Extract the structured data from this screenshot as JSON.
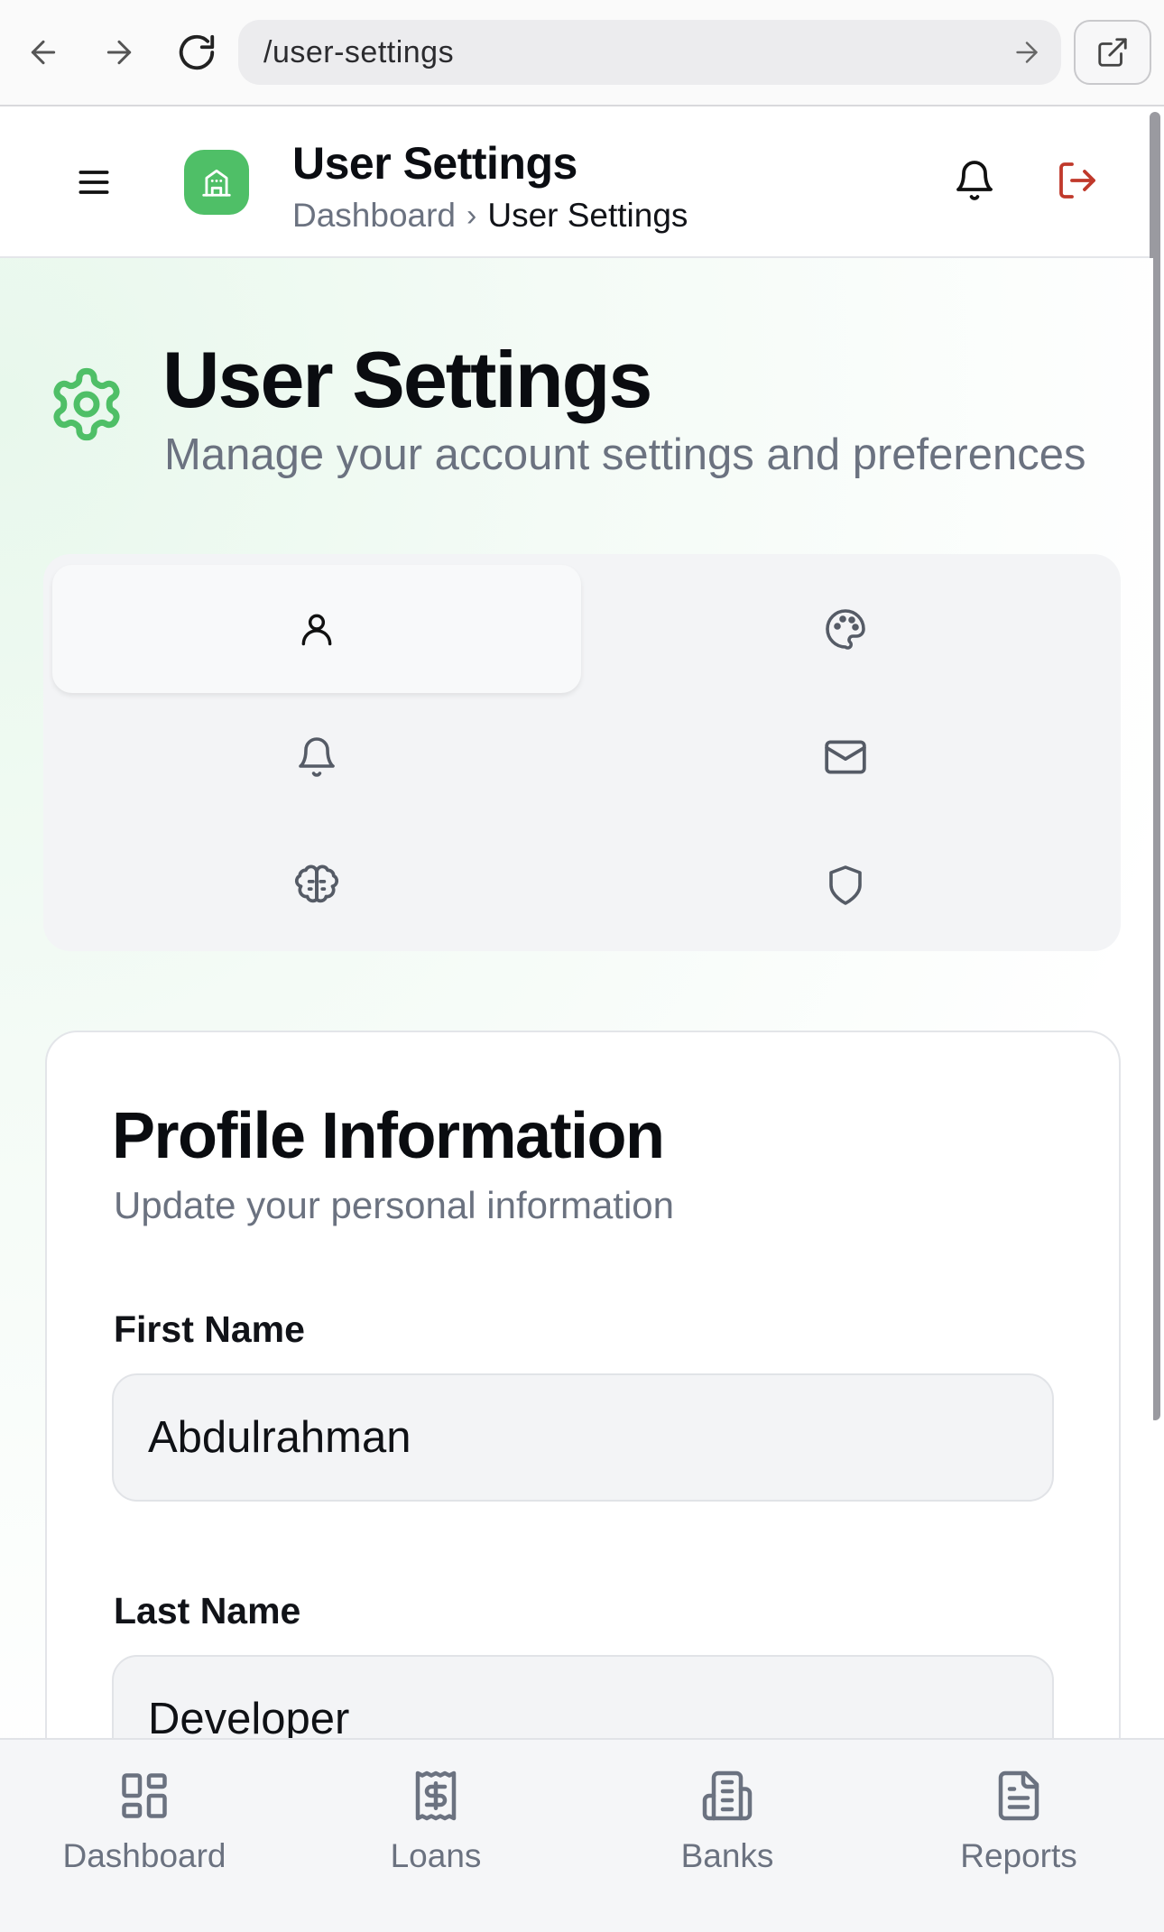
{
  "browser": {
    "url": "/user-settings",
    "back_icon": "arrow-left-icon",
    "forward_icon": "arrow-right-icon",
    "reload_icon": "reload-icon",
    "open_external_icon": "external-link-icon"
  },
  "header": {
    "title": "User Settings",
    "breadcrumb": {
      "home": "Dashboard",
      "separator": "›",
      "current": "User Settings"
    },
    "logo_color": "#4fbf67",
    "logout_color": "#c0392b"
  },
  "page": {
    "title": "User Settings",
    "subtitle": "Manage your account settings and preferences",
    "accent": "#4fbf67"
  },
  "tabs": [
    {
      "icon": "user-icon",
      "active": true
    },
    {
      "icon": "palette-icon",
      "active": false
    },
    {
      "icon": "bell-icon",
      "active": false
    },
    {
      "icon": "mail-icon",
      "active": false
    },
    {
      "icon": "brain-icon",
      "active": false
    },
    {
      "icon": "shield-icon",
      "active": false
    }
  ],
  "profile": {
    "title": "Profile Information",
    "subtitle": "Update your personal information",
    "first_name_label": "First Name",
    "first_name_value": "Abdulrahman",
    "last_name_label": "Last Name",
    "last_name_value": "Developer"
  },
  "bottom_nav": [
    {
      "label": "Dashboard",
      "icon": "dashboard-icon"
    },
    {
      "label": "Loans",
      "icon": "receipt-dollar-icon"
    },
    {
      "label": "Banks",
      "icon": "bank-icon"
    },
    {
      "label": "Reports",
      "icon": "file-text-icon"
    }
  ]
}
